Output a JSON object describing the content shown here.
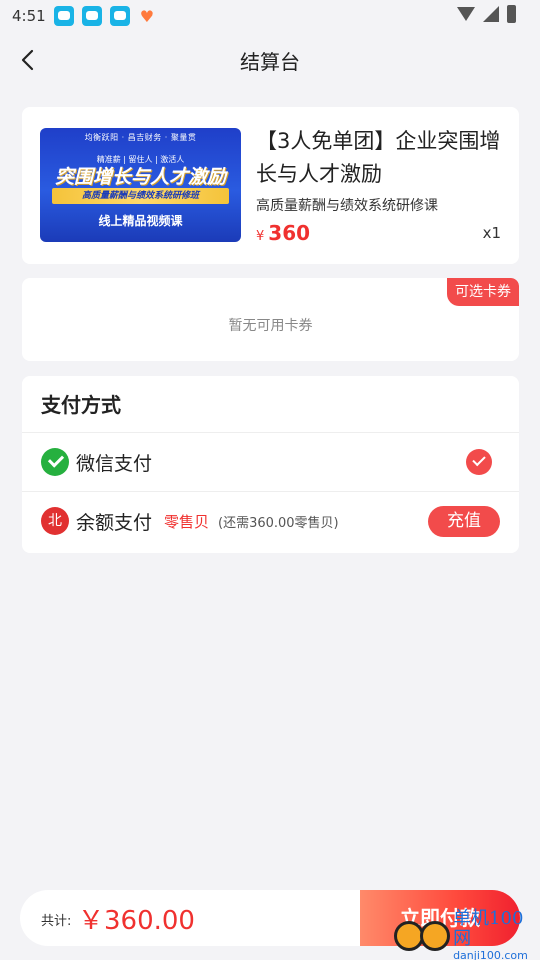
{
  "status_bar": {
    "time": "4:51"
  },
  "nav": {
    "title": "结算台"
  },
  "product": {
    "thumbnail": {
      "logos": "均衡跃阳 · 昌吉财务 · 聚量贯",
      "tags": "精准薪 | 留住人 | 激活人",
      "headline": "突围增长与人才激励",
      "banner": "高质量薪酬与绩效系统研修班",
      "sub": "线上精品视频课"
    },
    "title": "【3人免单团】企业突围增长与人才激励",
    "subtitle": "高质量薪酬与绩效系统研修课",
    "price_symbol": "¥",
    "price": "360",
    "quantity": "x1"
  },
  "coupon": {
    "tag": "可选卡券",
    "empty_text": "暂无可用卡券"
  },
  "payment": {
    "heading": "支付方式",
    "wechat_label": "微信支付",
    "balance_label": "余额支付",
    "balance_tag": "零售贝",
    "balance_note": "(还需360.00零售贝)",
    "recharge_label": "充值",
    "balance_icon_text": "北"
  },
  "footer": {
    "total_label": "共计:",
    "total_value": "￥360.00",
    "pay_button": "立即付款"
  },
  "watermark": {
    "main": "单机100网",
    "url": "danji100.com"
  },
  "colors": {
    "accent_red": "#f24b4b",
    "price_red": "#f0312f",
    "wechat_green": "#26b03f",
    "background": "#f3f3f6"
  }
}
